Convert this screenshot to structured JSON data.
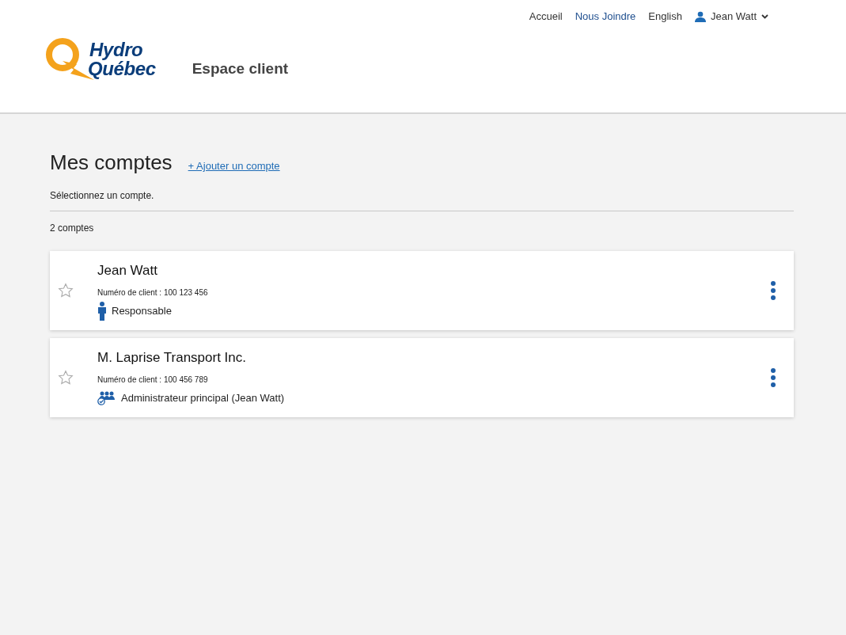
{
  "top_nav": {
    "links": [
      "Accueil",
      "Nous Joindre",
      "English"
    ],
    "user": "Jean Watt"
  },
  "logo": {
    "line_1": "Hydro",
    "line_2": "Québec"
  },
  "site_title": "Espace client",
  "page": {
    "title": "Mes comptes",
    "add_link": "+ Ajouter un compte",
    "instruction": "Sélectionnez un compte.",
    "count": "2 comptes"
  },
  "accounts": [
    {
      "name": "Jean Watt",
      "client_number": "Numéro de client : 100 123 456",
      "role": {
        "kind": "person",
        "label": "Responsable"
      },
      "favorite": false
    },
    {
      "name": "M. Laprise Transport Inc.",
      "client_number": "Numéro de client : 100 456 789",
      "role": {
        "kind": "group",
        "label": "Administrateur principal (Jean Watt)"
      },
      "favorite": false
    }
  ]
}
